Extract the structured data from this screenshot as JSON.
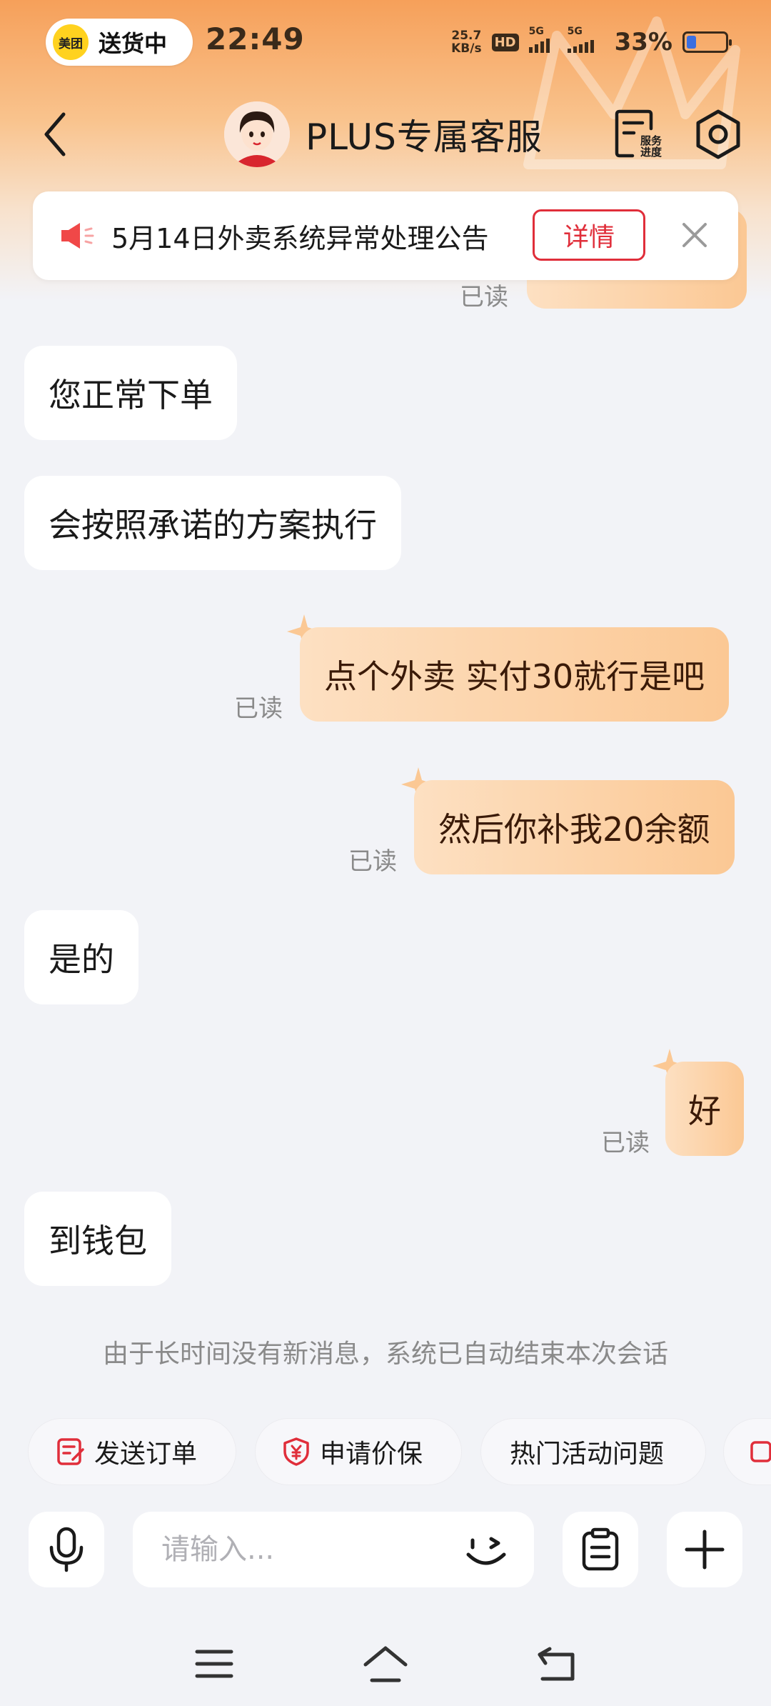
{
  "status_bar": {
    "delivery_logo_text": "美团",
    "delivery_text": "送货中",
    "time": "22:49",
    "net_speed_value": "25.7",
    "net_speed_unit": "KB/s",
    "hd_label": "HD",
    "signal_1_label": "5G",
    "signal_2_label": "5G",
    "battery_percent": "33%",
    "battery_level": 0.33
  },
  "header": {
    "title": "PLUS专属客服",
    "service_progress_label_1": "服务",
    "service_progress_label_2": "进度",
    "back_icon": "chevron-left-icon",
    "settings_icon": "gear-icon"
  },
  "notice": {
    "text": "5月14日外卖系统异常处理公告",
    "detail_label": "详情",
    "icon": "speaker-icon"
  },
  "colors": {
    "accent_red": "#e02e3a",
    "outgoing_bubble": "#fbc894",
    "header_orange": "#f6a05a"
  },
  "messages": {
    "top_read": "已读",
    "m1": "您正常下单",
    "m2": "会按照承诺的方案执行",
    "m3": "点个外卖 实付30就行是吧",
    "m3_read": "已读",
    "m4": "然后你补我20余额",
    "m4_read": "已读",
    "m5": "是的",
    "m6": "好",
    "m6_read": "已读",
    "m7": "到钱包"
  },
  "system_message": "由于长时间没有新消息，系统已自动结束本次会话",
  "quick_actions": {
    "send_order": "发送订单",
    "price_protect": "申请价保",
    "hot_questions": "热门活动问题"
  },
  "input": {
    "placeholder": "请输入..."
  }
}
